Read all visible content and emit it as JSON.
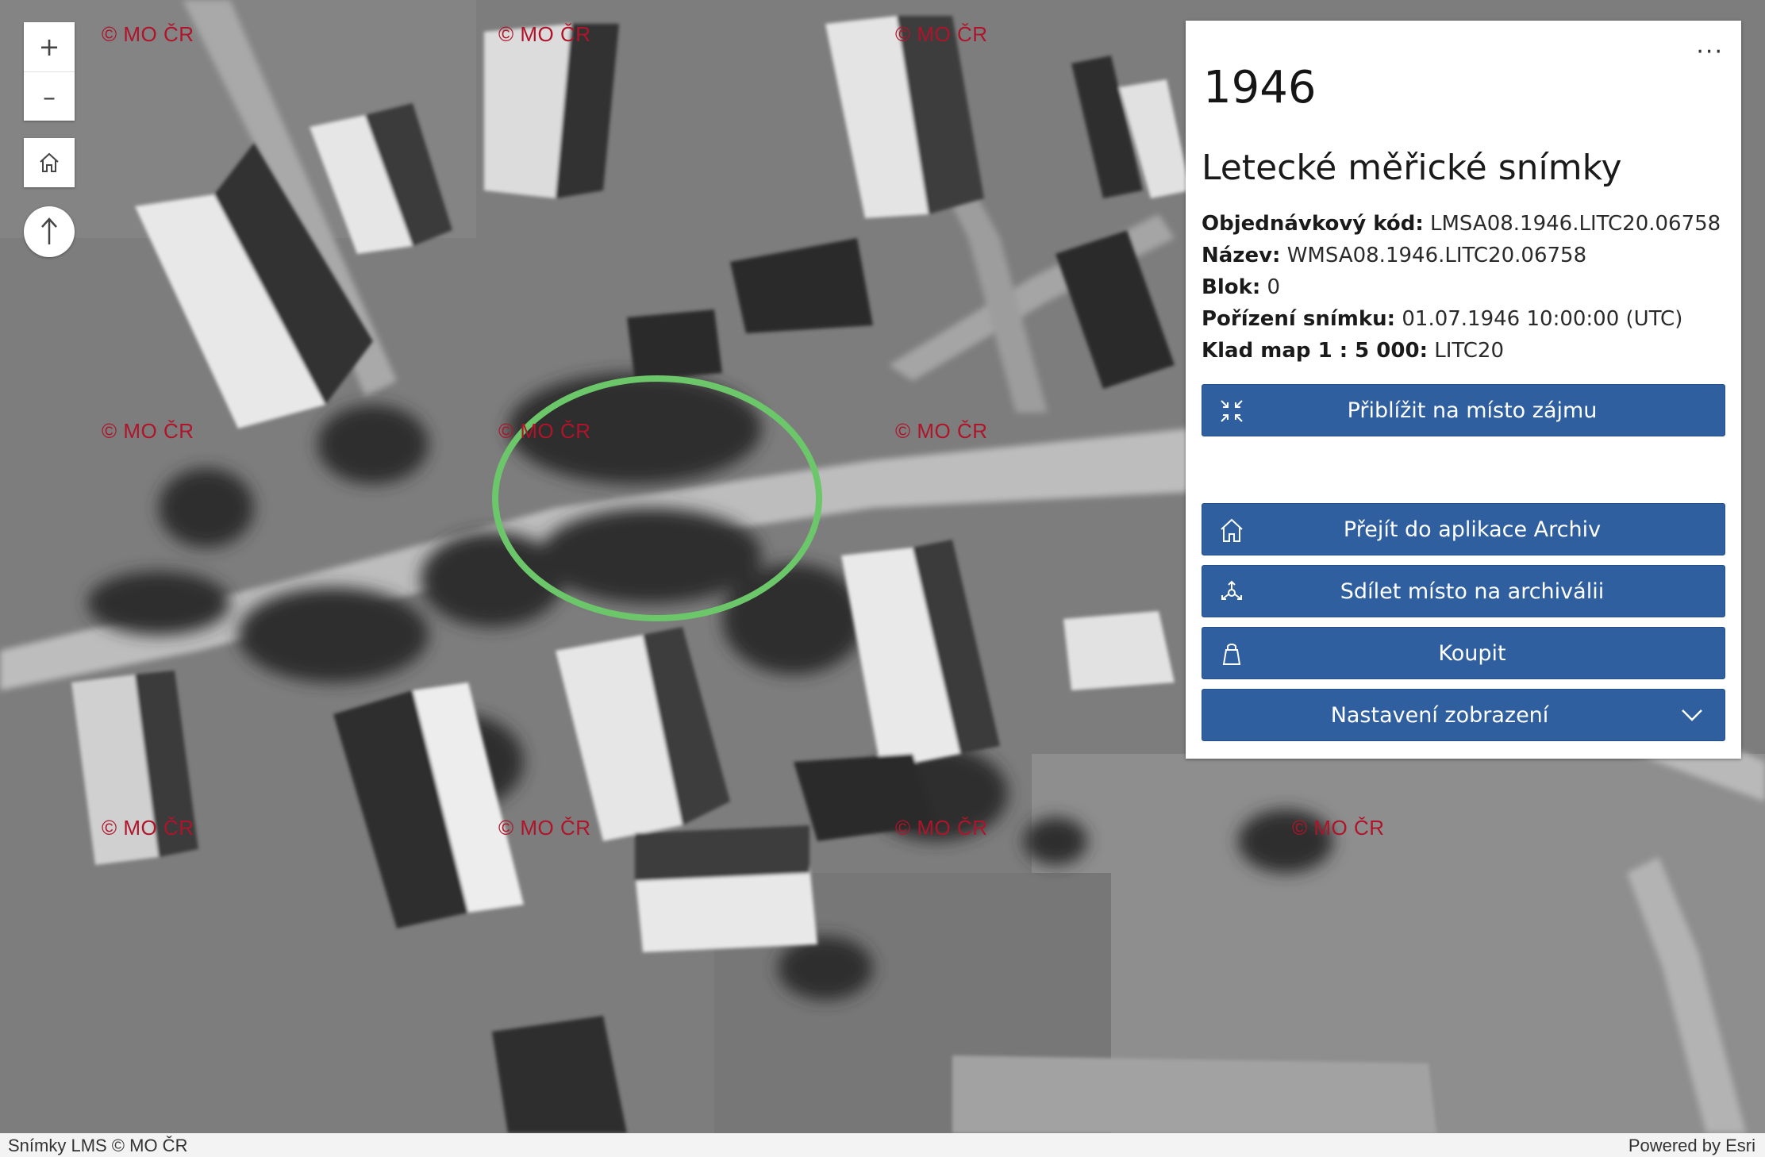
{
  "map": {
    "watermark_text": "© MO ČR",
    "aoi_circle_color": "#6cc76a"
  },
  "controls": {
    "zoom_in": "+",
    "zoom_out": "–"
  },
  "panel": {
    "menu": "···",
    "year": "1946",
    "title": "Letecké měřické snímky",
    "attributes": [
      {
        "label": "Objednávkový kód:",
        "value": "LMSA08.1946.LITC20.06758"
      },
      {
        "label": "Název:",
        "value": "WMSA08.1946.LITC20.06758"
      },
      {
        "label": "Blok:",
        "value": "0"
      },
      {
        "label": "Pořízení snímku:",
        "value": "01.07.1946 10:00:00 (UTC)"
      },
      {
        "label": "Klad map 1 : 5 000:",
        "value": "LITC20"
      }
    ],
    "buttons": {
      "zoom_to_aoi": "Přiblížit na místo zájmu",
      "open_archive": "Přejít do aplikace Archiv",
      "share": "Sdílet místo na archiválii",
      "buy": "Koupit",
      "display_settings": "Nastavení zobrazení"
    },
    "accent_color": "#2f5f9f"
  },
  "footer": {
    "attribution": "Snímky LMS © MO ČR",
    "powered_by": "Powered by Esri"
  }
}
